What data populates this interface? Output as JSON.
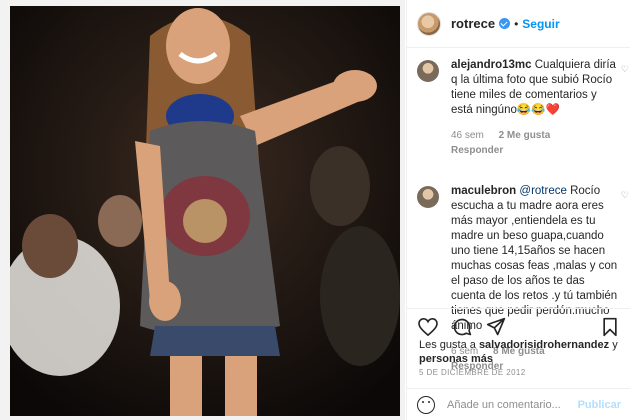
{
  "post": {
    "username": "rotrece",
    "follow_label": "Seguir",
    "separator": "•"
  },
  "comments": [
    {
      "user": "alejandro13mc",
      "text": "Cualquiera diría q la última foto que subió Rocío tiene miles de comentarios y está ningúno😂😂❤️",
      "age": "46 sem",
      "likes": "2 Me gusta",
      "reply": "Responder"
    },
    {
      "user": "maculebron",
      "mention": "@rotrece",
      "text": "Rocío escucha a tu madre aora eres más mayor ,entiendela es tu madre un beso guapa,cuando uno tiene 14,15años se hacen muchas cosas feas ,malas y con el paso de los años te das cuenta de los retos .y tú también tienes que pedir perdón.mucho ánimo",
      "age": "6 sem",
      "likes": "8 Me gusta",
      "reply": "Responder"
    }
  ],
  "likes": {
    "prefix": "Les gusta a",
    "user": "salvadorisidrohernandez",
    "joiner": "y",
    "others": "personas más"
  },
  "date": "5 DE DICIEMBRE DE 2012",
  "add_comment": {
    "placeholder": "Añade un comentario...",
    "publish_label": "Publicar"
  },
  "icons": {
    "heart": "heart-icon",
    "comment": "comment-icon",
    "share": "share-icon",
    "save": "bookmark-icon",
    "emoji": "emoji-icon",
    "verified": "verified-badge-icon"
  },
  "colors": {
    "link": "#0095f6",
    "verified": "#3897f0",
    "muted": "#8e8e8e"
  }
}
